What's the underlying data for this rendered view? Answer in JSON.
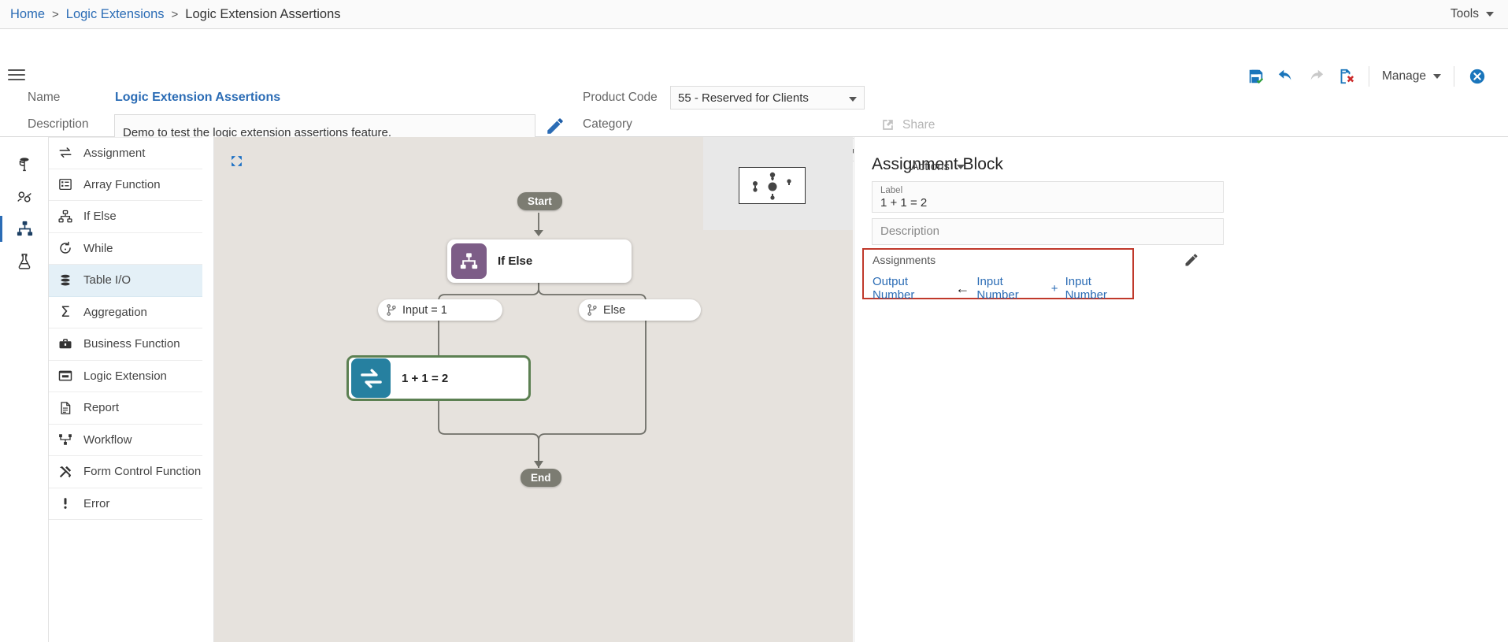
{
  "breadcrumb": {
    "items": [
      {
        "label": "Home",
        "link": true
      },
      {
        "label": "Logic Extensions",
        "link": true
      },
      {
        "label": "Logic Extension Assertions",
        "link": false
      }
    ],
    "separator": ">"
  },
  "topbar": {
    "tools_label": "Tools"
  },
  "header": {
    "name_label": "Name",
    "name_value": "Logic Extension Assertions",
    "description_label": "Description",
    "description_value": "Demo to test the logic extension assertions feature.",
    "description_placeholder": "Description",
    "product_code_label": "Product Code",
    "product_code_value": "55 - Reserved for Clients",
    "category_label": "Category",
    "category_value": "",
    "share_label": "Share",
    "manage_label": "Manage",
    "icons": {
      "save": "save-icon",
      "undo": "undo-icon",
      "redo": "redo-icon",
      "delete": "delete-icon",
      "close": "close-icon",
      "edit": "pencil-icon",
      "menu": "hamburger-icon"
    }
  },
  "rail": {
    "items": [
      {
        "name": "data-dictionary",
        "active": false
      },
      {
        "name": "variables",
        "active": false
      },
      {
        "name": "business-logic",
        "active": true
      },
      {
        "name": "testing",
        "active": false
      }
    ]
  },
  "palette": {
    "items": [
      {
        "label": "Assignment",
        "icon": "assignment-icon",
        "selected": false
      },
      {
        "label": "Array Function",
        "icon": "array-function-icon",
        "selected": false
      },
      {
        "label": "If Else",
        "icon": "if-else-icon",
        "selected": false
      },
      {
        "label": "While",
        "icon": "while-icon",
        "selected": false
      },
      {
        "label": "Table I/O",
        "icon": "table-io-icon",
        "selected": true
      },
      {
        "label": "Aggregation",
        "icon": "aggregation-icon",
        "selected": false
      },
      {
        "label": "Business Function",
        "icon": "business-function-icon",
        "selected": false
      },
      {
        "label": "Logic Extension",
        "icon": "logic-extension-icon",
        "selected": false
      },
      {
        "label": "Report",
        "icon": "report-icon",
        "selected": false
      },
      {
        "label": "Workflow",
        "icon": "workflow-icon",
        "selected": false
      },
      {
        "label": "Form Control Function",
        "icon": "form-control-function-icon",
        "selected": false
      },
      {
        "label": "Error",
        "icon": "error-icon",
        "selected": false
      }
    ]
  },
  "canvas": {
    "expand_icon": "expand-icon",
    "start_label": "Start",
    "end_label": "End",
    "if_else_label": "If Else",
    "branch_true_label": "Input = 1",
    "branch_else_label": "Else",
    "assignment_label": "1 + 1 = 2",
    "colors": {
      "canvas_bg": "#e6e2dd",
      "if_else_icon_bg": "#7d5d87",
      "assignment_icon_bg": "#2680a0",
      "selected_border": "#5c8052",
      "pill_bg": "#7c7c72"
    }
  },
  "properties": {
    "title": "Assignment Block",
    "actions_label": "Actions",
    "label_caption": "Label",
    "label_value": "1 + 1 = 2",
    "description_placeholder": "Description",
    "assignments_caption": "Assignments",
    "assignment_rows": [
      {
        "target": "Output Number",
        "arrow": "←",
        "operand_left": "Input Number",
        "operator": "+",
        "operand_right": "Input Number"
      }
    ],
    "highlight_color": "#c0392b",
    "edit_icon": "pencil-icon"
  }
}
